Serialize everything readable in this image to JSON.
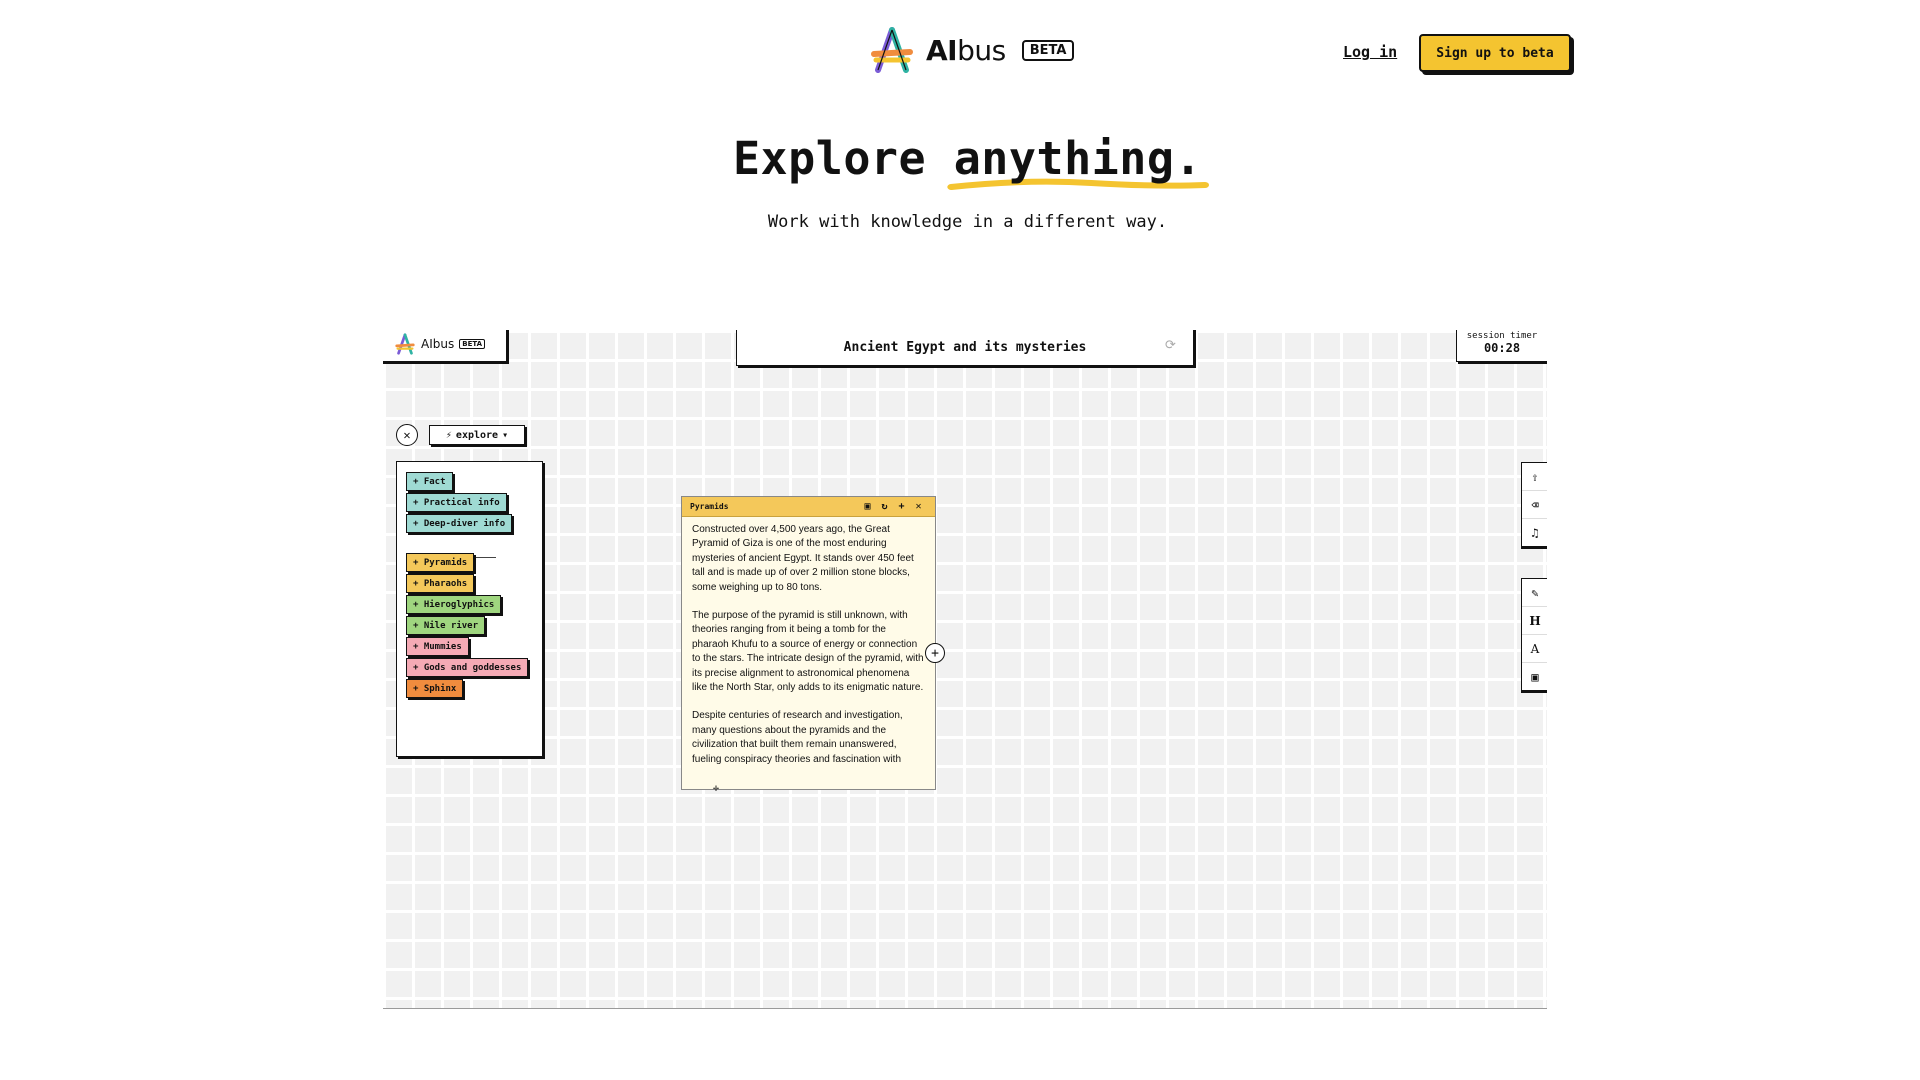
{
  "nav": {
    "brand": "AIbus",
    "brand_bold": "AI",
    "brand_rest": "bus",
    "beta": "BETA",
    "login": "Log in",
    "signup": "Sign up to beta"
  },
  "hero": {
    "title_start": "Explore ",
    "title_highlight": "anything.",
    "subtitle": "Work with knowledge in a different way."
  },
  "app": {
    "brand": "AIbus",
    "beta": "BETA",
    "topic": "Ancient Egypt and its mysteries",
    "timer_label": "session timer",
    "timer_value": "00:28",
    "mode": "explore",
    "palette": {
      "generic": [
        {
          "label": "+ Fact",
          "color": "#9fdad3"
        },
        {
          "label": "+ Practical info",
          "color": "#9fdad3"
        },
        {
          "label": "+ Deep-diver info",
          "color": "#9fdad3"
        }
      ],
      "topics": [
        {
          "label": "+ Pyramids",
          "color": "#f4c85a"
        },
        {
          "label": "+ Pharaohs",
          "color": "#f4c85a"
        },
        {
          "label": "+ Hieroglyphics",
          "color": "#9fd67f"
        },
        {
          "label": "+ Nile river",
          "color": "#9fd67f"
        },
        {
          "label": "+ Mummies",
          "color": "#f5aab5"
        },
        {
          "label": "+ Gods and goddesses",
          "color": "#f5aab5"
        },
        {
          "label": "+ Sphinx",
          "color": "#f08c3e"
        }
      ]
    },
    "card": {
      "title": "Pyramids",
      "paragraphs": [
        "Constructed over 4,500 years ago, the Great Pyramid of Giza is one of the most enduring mysteries of ancient Egypt. It stands over 450 feet tall and is made up of over 2 million stone blocks, some weighing up to 80 tons.",
        "The purpose of the pyramid is still unknown, with theories ranging from it being a tomb for the pharaoh Khufu to a source of energy or connection to the stars. The intricate design of the pyramid, with its precise alignment to astronomical phenomena like the North Star, only adds to its enigmatic nature.",
        "Despite centuries of research and investigation, many questions about the pyramids and the civilization that built them remain unanswered, fueling conspiracy theories and fascination with"
      ]
    }
  }
}
